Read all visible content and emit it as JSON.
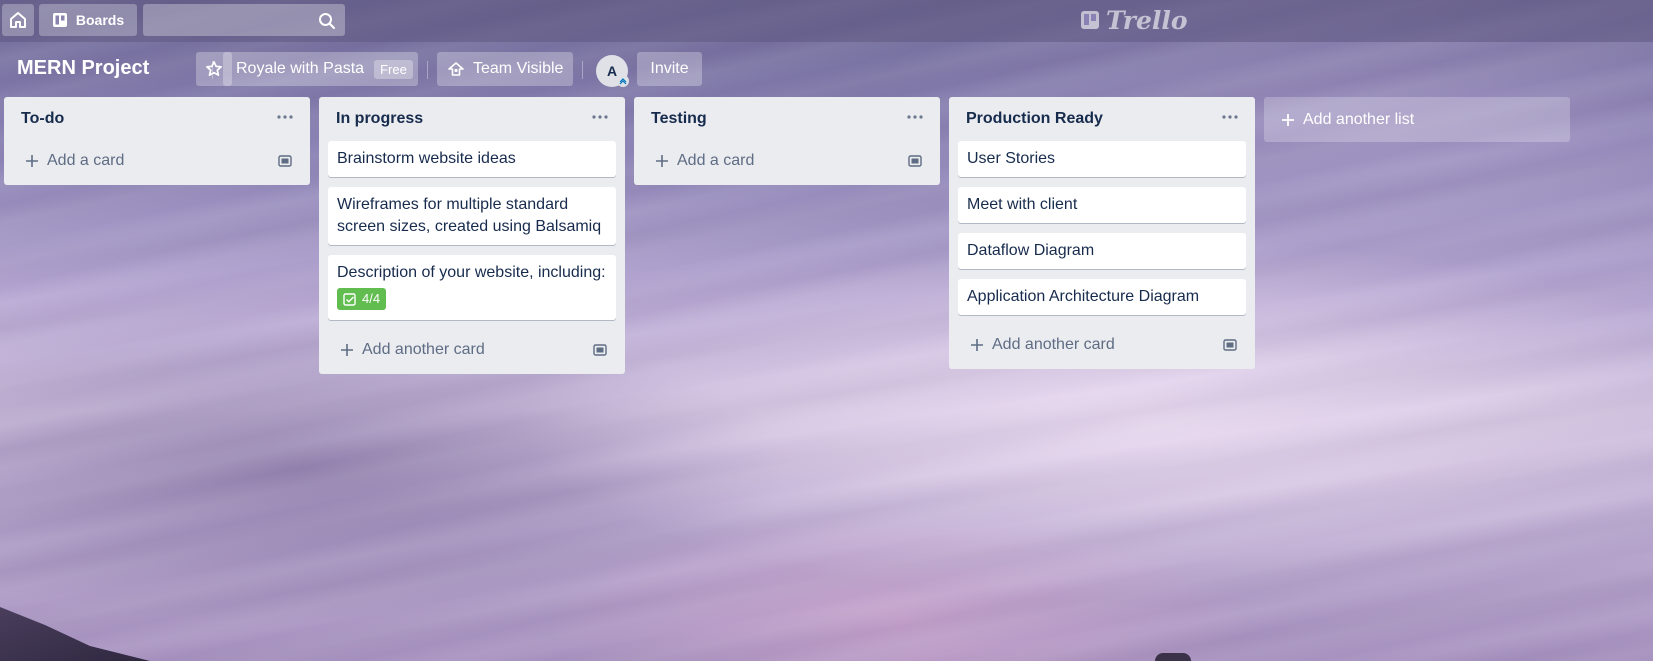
{
  "header": {
    "boards_label": "Boards",
    "search": {
      "value": "",
      "placeholder": ""
    },
    "logo_text": "Trello",
    "icons": {
      "home": "home-icon",
      "boards": "boards-icon",
      "search": "search-icon"
    }
  },
  "board": {
    "title": "MERN Project",
    "team_name": "Royale with Pasta",
    "team_plan": "Free",
    "visibility": "Team Visible",
    "member_initial": "A",
    "invite_label": "Invite"
  },
  "lists": [
    {
      "title": "To-do",
      "cards": [],
      "composer_label": "Add a card"
    },
    {
      "title": "In progress",
      "cards": [
        {
          "title": "Brainstorm website ideas"
        },
        {
          "title": "Wireframes for multiple standard screen sizes, created using Balsamiq"
        },
        {
          "title": "Description of your website, including:",
          "checklist": "4/4"
        }
      ],
      "composer_label": "Add another card"
    },
    {
      "title": "Testing",
      "cards": [],
      "composer_label": "Add a card"
    },
    {
      "title": "Production Ready",
      "cards": [
        {
          "title": "User Stories"
        },
        {
          "title": "Meet with client"
        },
        {
          "title": "Dataflow Diagram"
        },
        {
          "title": "Application Architecture Diagram"
        }
      ],
      "composer_label": "Add another card"
    }
  ],
  "add_list_label": "Add another list",
  "colors": {
    "checklist_complete": "#61bd4f",
    "list_bg": "#ebecf0",
    "text": "#172b4d"
  }
}
